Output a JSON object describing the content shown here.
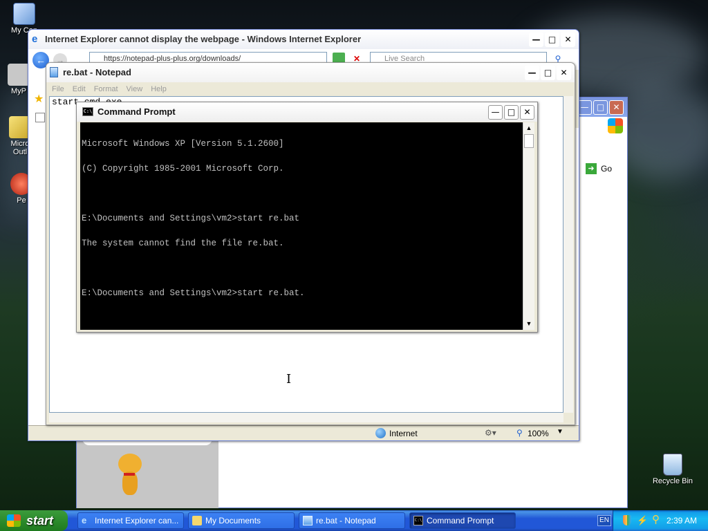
{
  "desktop": {
    "icons": [
      {
        "label": "My Con"
      },
      {
        "label": "MyP"
      },
      {
        "label": "Micro Outl"
      },
      {
        "label": "Pe"
      },
      {
        "label": "Recycle Bin"
      }
    ]
  },
  "ie_window": {
    "title": "Internet Explorer cannot display the webpage - Windows Internet Explorer",
    "address": "https://notepad-plus-plus.org/downloads/",
    "search_placeholder": "Live Search",
    "status_zone": "Internet",
    "zoom": "100%"
  },
  "bg_window": {
    "go_label": "Go"
  },
  "notepad": {
    "title": "re.bat - Notepad",
    "menu": [
      "File",
      "Edit",
      "Format",
      "View",
      "Help"
    ],
    "content": "start cmd.exe"
  },
  "cmd": {
    "title": "Command Prompt",
    "lines": [
      "Microsoft Windows XP [Version 5.1.2600]",
      "(C) Copyright 1985-2001 Microsoft Corp.",
      "",
      "E:\\Documents and Settings\\vm2>start re.bat",
      "The system cannot find the file re.bat.",
      "",
      "E:\\Documents and Settings\\vm2>start re.bat."
    ]
  },
  "taskbar": {
    "start_label": "start",
    "tasks": [
      {
        "label": "Internet Explorer can..."
      },
      {
        "label": "My Documents"
      },
      {
        "label": "re.bat - Notepad"
      },
      {
        "label": "Command Prompt"
      }
    ],
    "lang": "EN",
    "clock": "2:39 AM"
  },
  "colors": {
    "xp_blue": "#0053ee",
    "cmd_bg": "#000000",
    "cmd_fg": "#c0c0c0",
    "start_green": "#2f8f2f"
  }
}
